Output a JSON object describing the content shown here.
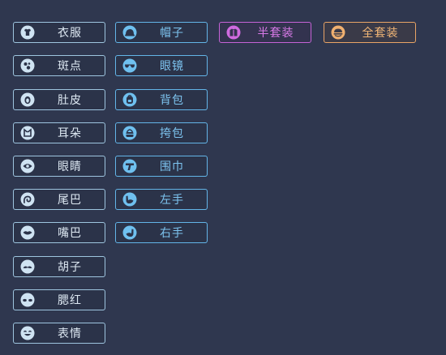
{
  "left_column": [
    {
      "label": "衣服",
      "icon": "shirt-icon"
    },
    {
      "label": "斑点",
      "icon": "spots-icon"
    },
    {
      "label": "肚皮",
      "icon": "belly-icon"
    },
    {
      "label": "耳朵",
      "icon": "ears-icon"
    },
    {
      "label": "眼睛",
      "icon": "eye-icon"
    },
    {
      "label": "尾巴",
      "icon": "tail-icon"
    },
    {
      "label": "嘴巴",
      "icon": "mouth-icon"
    },
    {
      "label": "胡子",
      "icon": "mustache-icon"
    },
    {
      "label": "腮红",
      "icon": "blush-icon"
    },
    {
      "label": "表情",
      "icon": "expression-icon"
    }
  ],
  "middle_column": [
    {
      "label": "帽子",
      "icon": "hat-icon"
    },
    {
      "label": "眼镜",
      "icon": "glasses-icon"
    },
    {
      "label": "背包",
      "icon": "backpack-icon"
    },
    {
      "label": "挎包",
      "icon": "shoulder-bag-icon"
    },
    {
      "label": "围巾",
      "icon": "scarf-icon"
    },
    {
      "label": "左手",
      "icon": "left-hand-icon"
    },
    {
      "label": "右手",
      "icon": "right-hand-icon"
    }
  ],
  "sets": {
    "half": {
      "label": "半套装",
      "icon": "half-set-icon"
    },
    "full": {
      "label": "全套装",
      "icon": "full-set-icon"
    }
  },
  "colors": {
    "background": "#2f374f",
    "left_border": "#9ec5df",
    "middle_border": "#63b5e8",
    "half_set": "#c563d6",
    "full_set": "#e9a466"
  }
}
